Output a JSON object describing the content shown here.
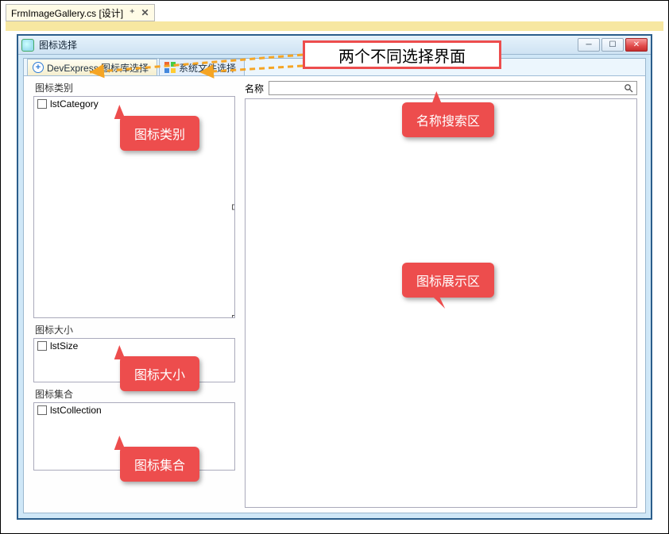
{
  "outerTab": {
    "filename": "FrmImageGallery.cs [设计]",
    "pin": "⊕",
    "close": "✕"
  },
  "window": {
    "title": "图标选择",
    "min": "─",
    "max": "☐",
    "close": "✕"
  },
  "tabs": {
    "dx": {
      "label": "DevExpress 图标库选择",
      "iconGlyph": "+"
    },
    "sys": {
      "label": "系统文件选择"
    }
  },
  "left": {
    "category": {
      "label": "图标类别",
      "item": "lstCategory"
    },
    "size": {
      "label": "图标大小",
      "item": "lstSize"
    },
    "collection": {
      "label": "图标集合",
      "item": "lstCollection"
    }
  },
  "search": {
    "label": "名称",
    "value": ""
  },
  "annotations": {
    "twoPages": "两个不同选择界面",
    "category": "图标类别",
    "size": "图标大小",
    "collection": "图标集合",
    "searchArea": "名称搜索区",
    "galleryArea": "图标展示区"
  }
}
